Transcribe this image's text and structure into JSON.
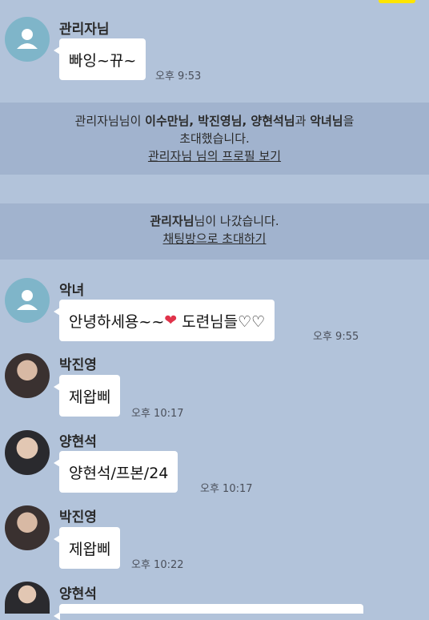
{
  "messages": [
    {
      "sender": "관리자님",
      "text": "빠잉~뀨~",
      "time": "오후 9:53"
    },
    {
      "sender": "악녀",
      "text_before": "안녕하세용~~",
      "heart": "❤",
      "text_after": " 도련님들♡♡",
      "time": "오후 9:55"
    },
    {
      "sender": "박진영",
      "text": "제왑삐",
      "time": "오후 10:17"
    },
    {
      "sender": "양현석",
      "text": "양현석/프본/24",
      "time": "오후 10:17"
    },
    {
      "sender": "박진영",
      "text": "제왑삐",
      "time": "오후 10:22"
    },
    {
      "sender": "양현석"
    }
  ],
  "notice_invite": {
    "inviter": "관리자님",
    "inviter_suffix": "님이 ",
    "invitees": "이수만님, 박진영님, 양현석님",
    "conj": "과 ",
    "last": "악녀님",
    "tail": "을",
    "line2": "초대했습니다.",
    "profile_link": "관리자님 님의 프로필 보기"
  },
  "notice_leave": {
    "who": "관리자님",
    "text": "님이 나갔습니다.",
    "link": "채팅방으로 초대하기"
  },
  "colors": {
    "background": "#b2c3da",
    "bubble": "#ffffff",
    "my_bubble": "#fee500",
    "default_avatar": "#7fb5c9"
  }
}
